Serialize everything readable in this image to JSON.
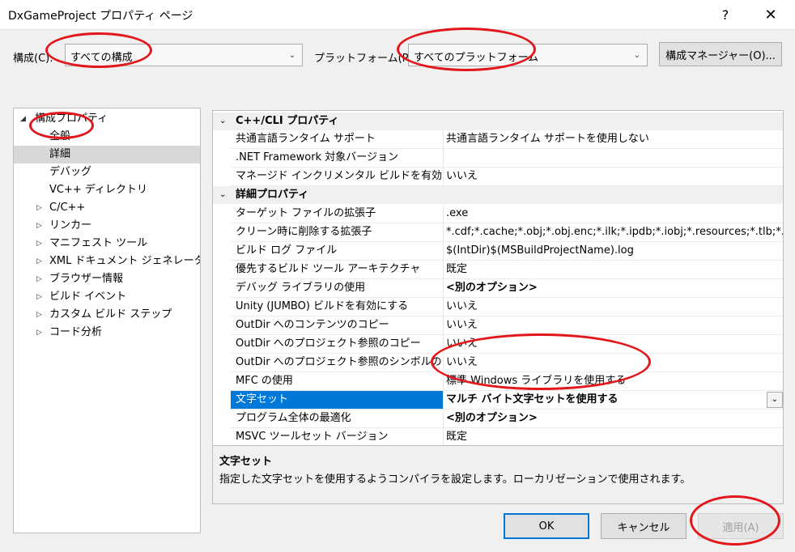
{
  "window": {
    "title": "DxGameProject プロパティ ページ",
    "help": "?",
    "close": "✕"
  },
  "config": {
    "label": "構成(C):",
    "value": "すべての構成"
  },
  "platform": {
    "label": "プラットフォーム(P):",
    "value": "すべてのプラットフォーム"
  },
  "config_manager": "構成マネージャー(O)...",
  "tree": {
    "root": "構成プロパティ",
    "items": [
      "全般",
      "詳細",
      "デバッグ",
      "VC++ ディレクトリ",
      "C/C++",
      "リンカー",
      "マニフェスト ツール",
      "XML ドキュメント ジェネレーター",
      "ブラウザー情報",
      "ビルド イベント",
      "カスタム ビルド ステップ",
      "コード分析"
    ]
  },
  "grid": {
    "cat1": "C++/CLI プロパティ",
    "cat1_rows": [
      {
        "name": "共通言語ランタイム サポート",
        "value": "共通言語ランタイム サポートを使用しない"
      },
      {
        "name": ".NET Framework 対象バージョン",
        "value": ""
      },
      {
        "name": "マネージド インクリメンタル ビルドを有効にする",
        "value": "いいえ"
      }
    ],
    "cat2": "詳細プロパティ",
    "cat2_rows": [
      {
        "name": "ターゲット ファイルの拡張子",
        "value": ".exe"
      },
      {
        "name": "クリーン時に削除する拡張子",
        "value": "*.cdf;*.cache;*.obj;*.obj.enc;*.ilk;*.ipdb;*.iobj;*.resources;*.tlb;*.tli;*.tl"
      },
      {
        "name": "ビルド ログ ファイル",
        "value": "$(IntDir)$(MSBuildProjectName).log"
      },
      {
        "name": "優先するビルド ツール アーキテクチャ",
        "value": "既定"
      },
      {
        "name": "デバッグ ライブラリの使用",
        "value": "<別のオプション>"
      },
      {
        "name": "Unity (JUMBO) ビルドを有効にする",
        "value": "いいえ"
      },
      {
        "name": "OutDir へのコンテンツのコピー",
        "value": "いいえ"
      },
      {
        "name": "OutDir へのプロジェクト参照のコピー",
        "value": "いいえ"
      },
      {
        "name": "OutDir へのプロジェクト参照のシンボルのコピー",
        "value": "いいえ"
      },
      {
        "name": "MFC の使用",
        "value": "標準 Windows ライブラリを使用する"
      },
      {
        "name": "文字セット",
        "value": "マルチ バイト文字セットを使用する"
      },
      {
        "name": "プログラム全体の最適化",
        "value": "<別のオプション>"
      },
      {
        "name": "MSVC ツールセット バージョン",
        "value": "既定"
      }
    ]
  },
  "description": {
    "title": "文字セット",
    "text": "指定した文字セットを使用するようコンパイラを設定します。ローカリゼーションで使用されます。"
  },
  "buttons": {
    "ok": "OK",
    "cancel": "キャンセル",
    "apply": "適用(A)"
  },
  "colors": {
    "selection": "#0078d7",
    "annotation": "#e3171b"
  }
}
